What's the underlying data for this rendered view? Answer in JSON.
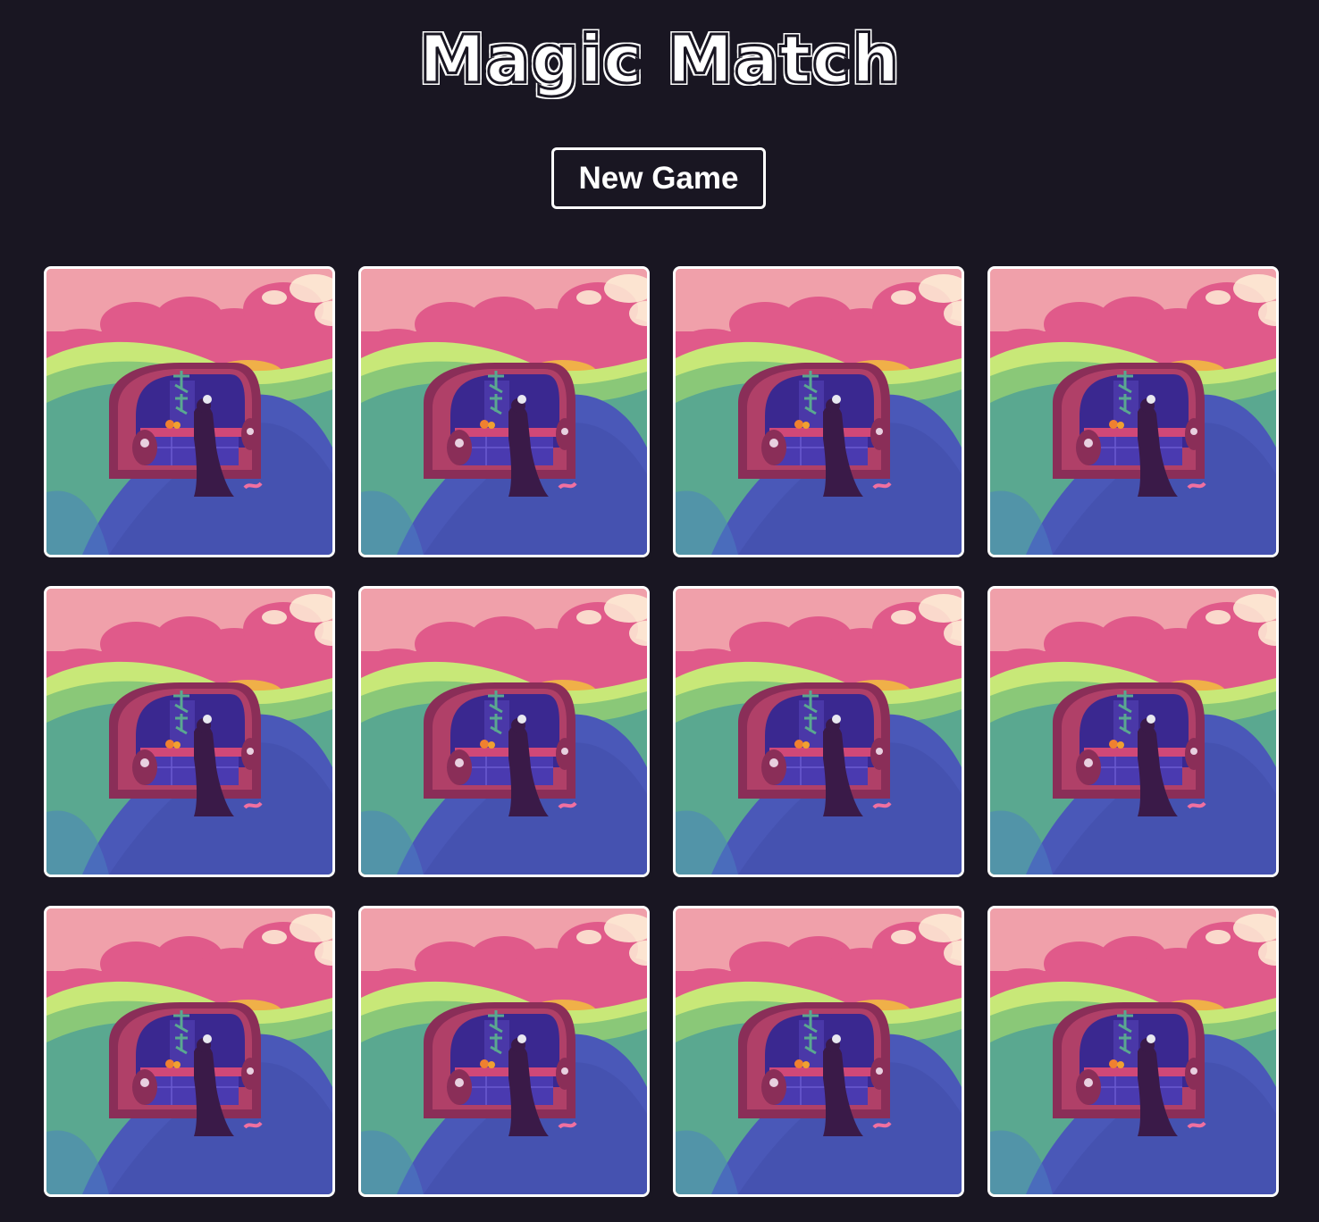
{
  "game": {
    "title": "Magic Match",
    "new_game_label": "New Game"
  },
  "board": {
    "rows": 3,
    "columns": 4,
    "cards": [
      {
        "state": "face-down",
        "art": "card-back-art"
      },
      {
        "state": "face-down",
        "art": "card-back-art"
      },
      {
        "state": "face-down",
        "art": "card-back-art"
      },
      {
        "state": "face-down",
        "art": "card-back-art"
      },
      {
        "state": "face-down",
        "art": "card-back-art"
      },
      {
        "state": "face-down",
        "art": "card-back-art"
      },
      {
        "state": "face-down",
        "art": "card-back-art"
      },
      {
        "state": "face-down",
        "art": "card-back-art"
      },
      {
        "state": "face-down",
        "art": "card-back-art"
      },
      {
        "state": "face-down",
        "art": "card-back-art"
      },
      {
        "state": "face-down",
        "art": "card-back-art"
      },
      {
        "state": "face-down",
        "art": "card-back-art"
      }
    ]
  },
  "colors": {
    "background": "#191622",
    "card_border": "#ffffff",
    "sky": "#f0a0aa",
    "clouds": "#e05a8a",
    "cloud_highlight": "#fff0d8",
    "hill_green": "#5aa890",
    "hill_yellow": "#c8e878",
    "path_blue": "#4a58b8",
    "sofa": "#b04068",
    "inner_purple": "#3a2890",
    "figure": "#3a1a48"
  }
}
